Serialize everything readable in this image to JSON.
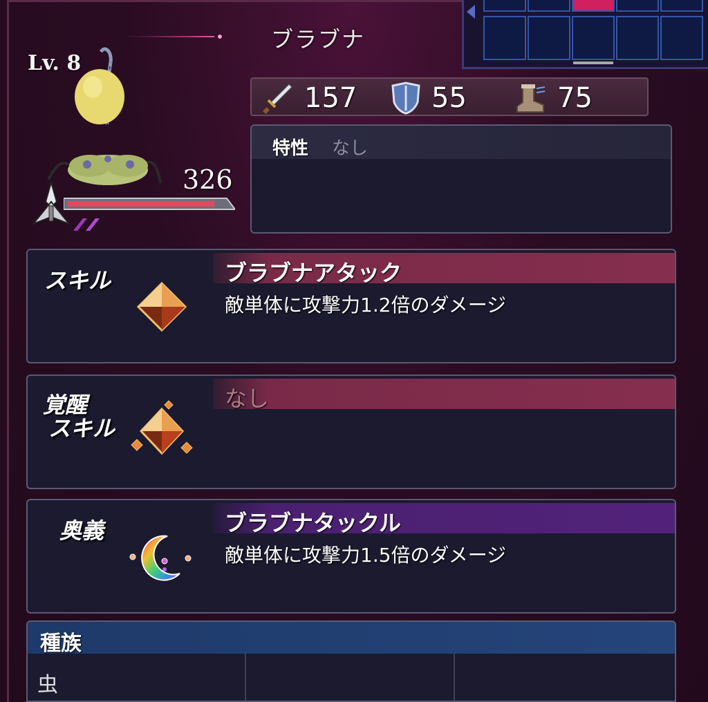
{
  "unit": {
    "name": "ブラブナ",
    "level": "Lv. 8",
    "hp": "326",
    "hp_fill": 0.93
  },
  "stats": [
    {
      "icon": "sword-icon",
      "value": "157"
    },
    {
      "icon": "shield-icon",
      "value": "55"
    },
    {
      "icon": "boot-icon",
      "value": "75"
    }
  ],
  "trait": {
    "label": "特性",
    "value": "なし"
  },
  "skill": {
    "label": "スキル",
    "name": "ブラブナアタック",
    "desc": "敵単体に攻撃力1.2倍のダメージ"
  },
  "awaken": {
    "label_line1": "覚醒",
    "label_line2": "スキル",
    "name": "なし"
  },
  "ougi": {
    "label": "奥義",
    "name": "ブラブナタックル",
    "desc": "敵単体に攻撃力1.5倍のダメージ"
  },
  "race": {
    "label": "種族",
    "values": [
      "虫",
      "",
      ""
    ]
  },
  "colors": {
    "skill_header": "#862e4e",
    "ougi_header": "#52227a",
    "race_header": "#25447a",
    "hp_bar": "#e04a5e",
    "panel_bg": "#1b1a2e"
  }
}
